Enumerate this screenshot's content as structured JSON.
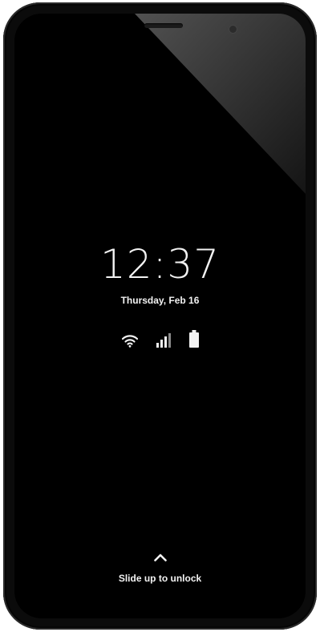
{
  "lockscreen": {
    "time": "12:37",
    "date": "Thursday, Feb 16",
    "status_icons": [
      "wifi-icon",
      "cellular-signal-icon",
      "battery-icon"
    ],
    "unlock_hint": "Slide up to unlock"
  },
  "colors": {
    "screen": "#000000",
    "text": "#f2f2f2",
    "bezel": "#0b0b0b"
  }
}
